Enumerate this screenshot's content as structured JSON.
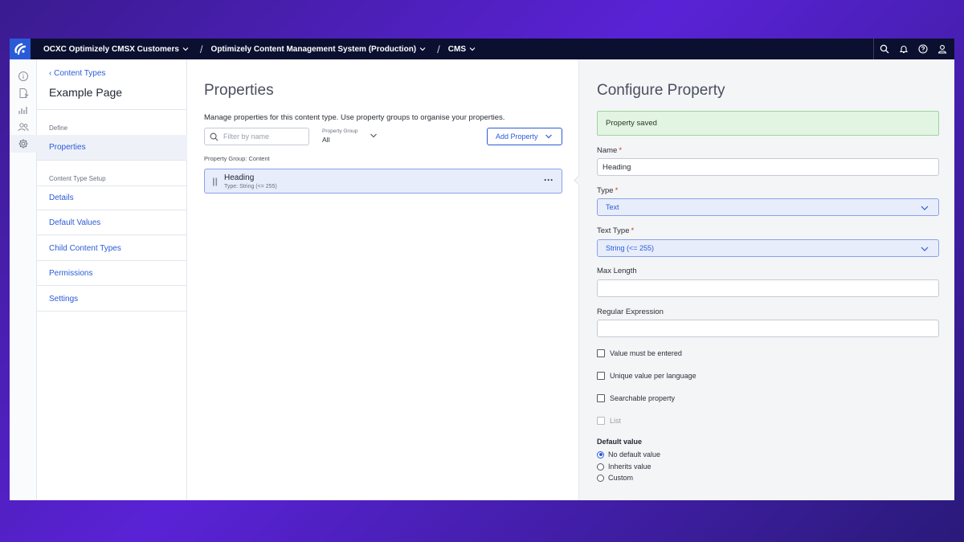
{
  "topbar": {
    "org": "OCXC Optimizely CMSX Customers",
    "instance": "Optimizely Content Management System (Production)",
    "product": "CMS",
    "separator": "/",
    "icons": [
      "search-icon",
      "bell-icon",
      "help-icon",
      "user-icon"
    ]
  },
  "rail": {
    "icons": [
      "info-icon",
      "document-icon",
      "chart-icon",
      "users-icon",
      "gear-icon"
    ],
    "active": "gear-icon"
  },
  "nav": {
    "back_label": "Content Types",
    "title": "Example Page",
    "define_section": "Define",
    "properties_item": "Properties",
    "setup_section": "Content Type Setup",
    "items": [
      "Details",
      "Default Values",
      "Child Content Types",
      "Permissions",
      "Settings"
    ]
  },
  "properties": {
    "heading": "Properties",
    "description": "Manage properties for this content type. Use property groups to organise your properties.",
    "filter_placeholder": "Filter by name",
    "group_filter_label": "Property Group",
    "group_filter_value": "All",
    "add_button": "Add Property",
    "group_label": "Property Group: Content",
    "rows": [
      {
        "name": "Heading",
        "type": "Type: String (<= 255)",
        "menu": "···"
      }
    ]
  },
  "config": {
    "heading": "Configure Property",
    "saved_message": "Property saved",
    "name_label": "Name",
    "name_value": "Heading",
    "required_mark": "*",
    "type_label": "Type",
    "type_value": "Text",
    "text_type_label": "Text Type",
    "text_type_value": "String (<= 255)",
    "max_length_label": "Max Length",
    "max_length_value": "",
    "regex_label": "Regular Expression",
    "regex_value": "",
    "checkboxes": [
      {
        "label": "Value must be entered",
        "checked": false,
        "disabled": false
      },
      {
        "label": "Unique value per language",
        "checked": false,
        "disabled": false
      },
      {
        "label": "Searchable property",
        "checked": false,
        "disabled": false
      },
      {
        "label": "List",
        "checked": false,
        "disabled": true
      }
    ],
    "default_value_label": "Default value",
    "default_options": [
      {
        "label": "No default value",
        "selected": true
      },
      {
        "label": "Inherits value",
        "selected": false
      },
      {
        "label": "Custom",
        "selected": false
      }
    ]
  },
  "colors": {
    "accent": "#2a5bd7",
    "topbar": "#0b1030",
    "success_bg": "#e2f4e2",
    "required": "#d9342b"
  }
}
